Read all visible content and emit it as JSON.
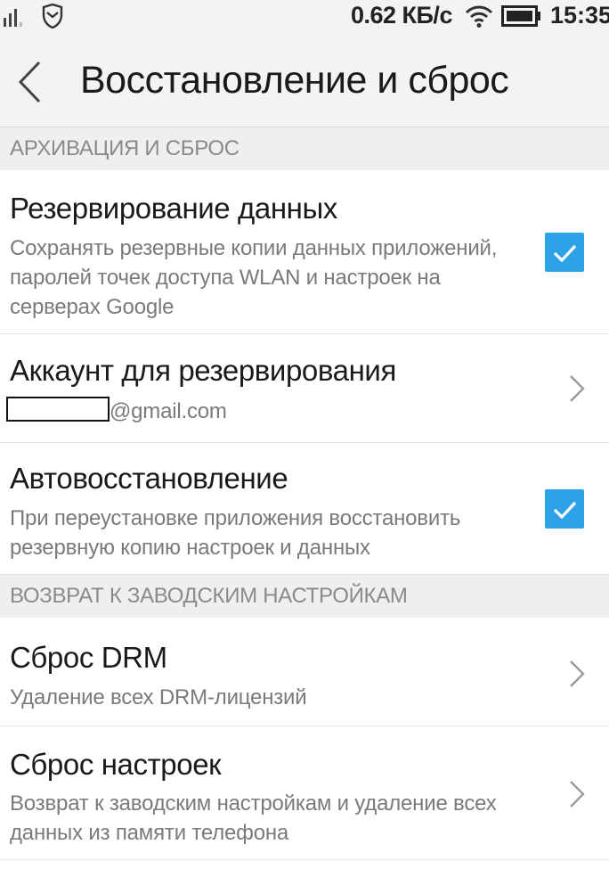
{
  "status_bar": {
    "network_speed": "0.62 КБ/с",
    "time": "15:35"
  },
  "header": {
    "title": "Восстановление и сброс"
  },
  "sections": [
    {
      "header": "АРХИВАЦИЯ И СБРОС",
      "items": [
        {
          "title": "Резервирование данных",
          "subtitle_lines": [
            "Сохранять резервные копии данных приложений,",
            "паролей точек доступа WLAN и настроек на",
            "серверах Google"
          ],
          "control": "checkbox",
          "checked": true
        },
        {
          "title": "Аккаунт для резервирования",
          "account_suffix": "@gmail.com",
          "control": "chevron"
        },
        {
          "title": "Автовосстановление",
          "subtitle_lines": [
            "При переустановке приложения восстановить",
            "резервную копию настроек и данных"
          ],
          "control": "checkbox",
          "checked": true
        }
      ]
    },
    {
      "header": "ВОЗВРАТ К ЗАВОДСКИМ НАСТРОЙКАМ",
      "items": [
        {
          "title": "Сброс DRM",
          "subtitle_lines": [
            "Удаление всех DRM-лицензий"
          ],
          "control": "chevron"
        },
        {
          "title": "Сброс настроек",
          "subtitle_lines": [
            "Возврат к заводским настройкам и удаление всех",
            "данных из памяти телефона"
          ],
          "control": "chevron"
        }
      ]
    }
  ],
  "colors": {
    "accent": "#2ea2e6",
    "section_bg": "#efefef",
    "section_text": "#8a8a8a"
  }
}
